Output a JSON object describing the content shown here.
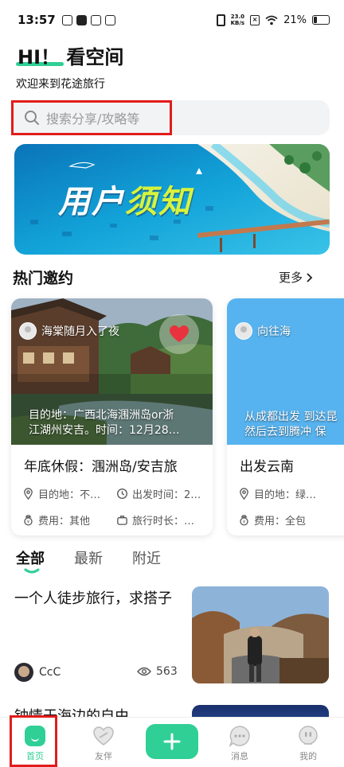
{
  "status_bar": {
    "time": "13:57",
    "net_speed_value": "23.0",
    "net_speed_unit": "KB/s",
    "battery": "21%",
    "battery_level": 0.21
  },
  "header": {
    "greeting": "HI！ 看空间",
    "subtitle": "欢迎来到花途旅行"
  },
  "search": {
    "placeholder": "搜索分享/攻略等"
  },
  "banner": {
    "title_main": "用户",
    "title_accent": "须知"
  },
  "hot_section": {
    "title": "热门邀约",
    "more_label": "更多"
  },
  "cards": [
    {
      "user": "海棠随月入了夜",
      "overlay_line1": "目的地：广西北海涠洲岛or浙",
      "overlay_line2": "江湖州安吉。时间：12月28…",
      "title": "年底休假：涠洲岛/安吉旅",
      "destination": "目的地：不…",
      "depart_time": "出发时间：2…",
      "cost": "费用：其他",
      "duration": "旅行时长：…"
    },
    {
      "user": "向往海",
      "overlay_line1": "从成都出发 到达昆",
      "overlay_line2": "然后去到腾冲 保",
      "title": "出发云南",
      "destination": "目的地：绿…",
      "cost": "费用：全包"
    }
  ],
  "tabs": [
    {
      "label": "全部",
      "active": true
    },
    {
      "label": "最新",
      "active": false
    },
    {
      "label": "附近",
      "active": false
    }
  ],
  "feed": [
    {
      "title": "一个人徒步旅行，求搭子",
      "author": "CcC",
      "views": "563"
    },
    {
      "title": "钟情于海边的自由"
    }
  ],
  "bottom_nav": {
    "home": "首页",
    "partner": "友伴",
    "messages": "消息",
    "mine": "我的"
  },
  "colors": {
    "accent": "#2fcf95",
    "highlight_box": "#e21b1b",
    "heart": "#e8333e"
  }
}
